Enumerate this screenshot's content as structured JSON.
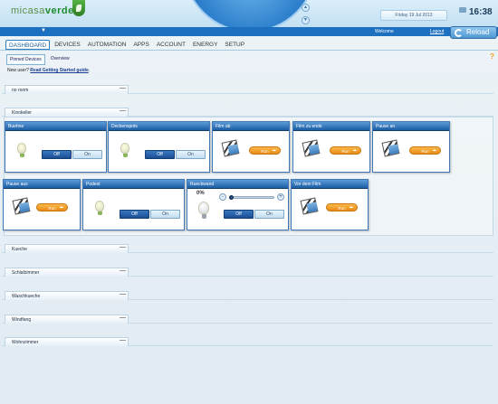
{
  "header": {
    "logo_micasa": "micasa",
    "logo_verde": "verde",
    "date": "Friday 19 Jul 2013",
    "time": "16:38",
    "welcome": "Welcome",
    "logout": "Logout",
    "reload": "Reload"
  },
  "nav": {
    "tabs": [
      "DASHBOARD",
      "DEVICES",
      "AUTOMATION",
      "APPS",
      "ACCOUNT",
      "ENERGY",
      "SETUP"
    ],
    "active": "DASHBOARD"
  },
  "subnav": {
    "tabs": [
      "Pinned Devices",
      "Overview"
    ]
  },
  "help_label": "?",
  "newuser": {
    "prefix": "New user? ",
    "link": "Read Getting Started guide",
    "suffix": "."
  },
  "rooms": {
    "no_room": "no room",
    "kinokeller": "Kinokeller",
    "kueche": "Kueche",
    "schlafzimmer": "Schlafzimmer",
    "waschkueche": "Waschkueche",
    "windfang": "Windfang",
    "wohnzimmer": "Wohnzimmer",
    "collapse_glyph": "—"
  },
  "devices": {
    "buehne": {
      "name": "Buehne",
      "off": "Off",
      "on": "On",
      "state": "off"
    },
    "deckenspots": {
      "name": "Deckenspots",
      "off": "Off",
      "on": "On",
      "state": "off"
    },
    "film_ab": {
      "name": "Film ab",
      "run": "Run"
    },
    "film_zu_ende": {
      "name": "Film zu ende",
      "run": "Run"
    },
    "pause_an": {
      "name": "Pause an",
      "run": "Run"
    },
    "pause_aus": {
      "name": "Pause aus",
      "run": "Run"
    },
    "podest": {
      "name": "Podest",
      "off": "Off",
      "on": "On",
      "state": "off"
    },
    "rueckwand": {
      "name": "Rueckwand",
      "off": "Off",
      "on": "On",
      "state": "off",
      "level_label": "0%",
      "level": 0,
      "minus": "-",
      "plus": "+"
    },
    "vor_dem_film": {
      "name": "Vor dem Film",
      "run": "Run"
    }
  },
  "colors": {
    "accent_blue": "#1d6fbf",
    "run_orange": "#f0a020",
    "off_blue": "#1a4e93"
  }
}
